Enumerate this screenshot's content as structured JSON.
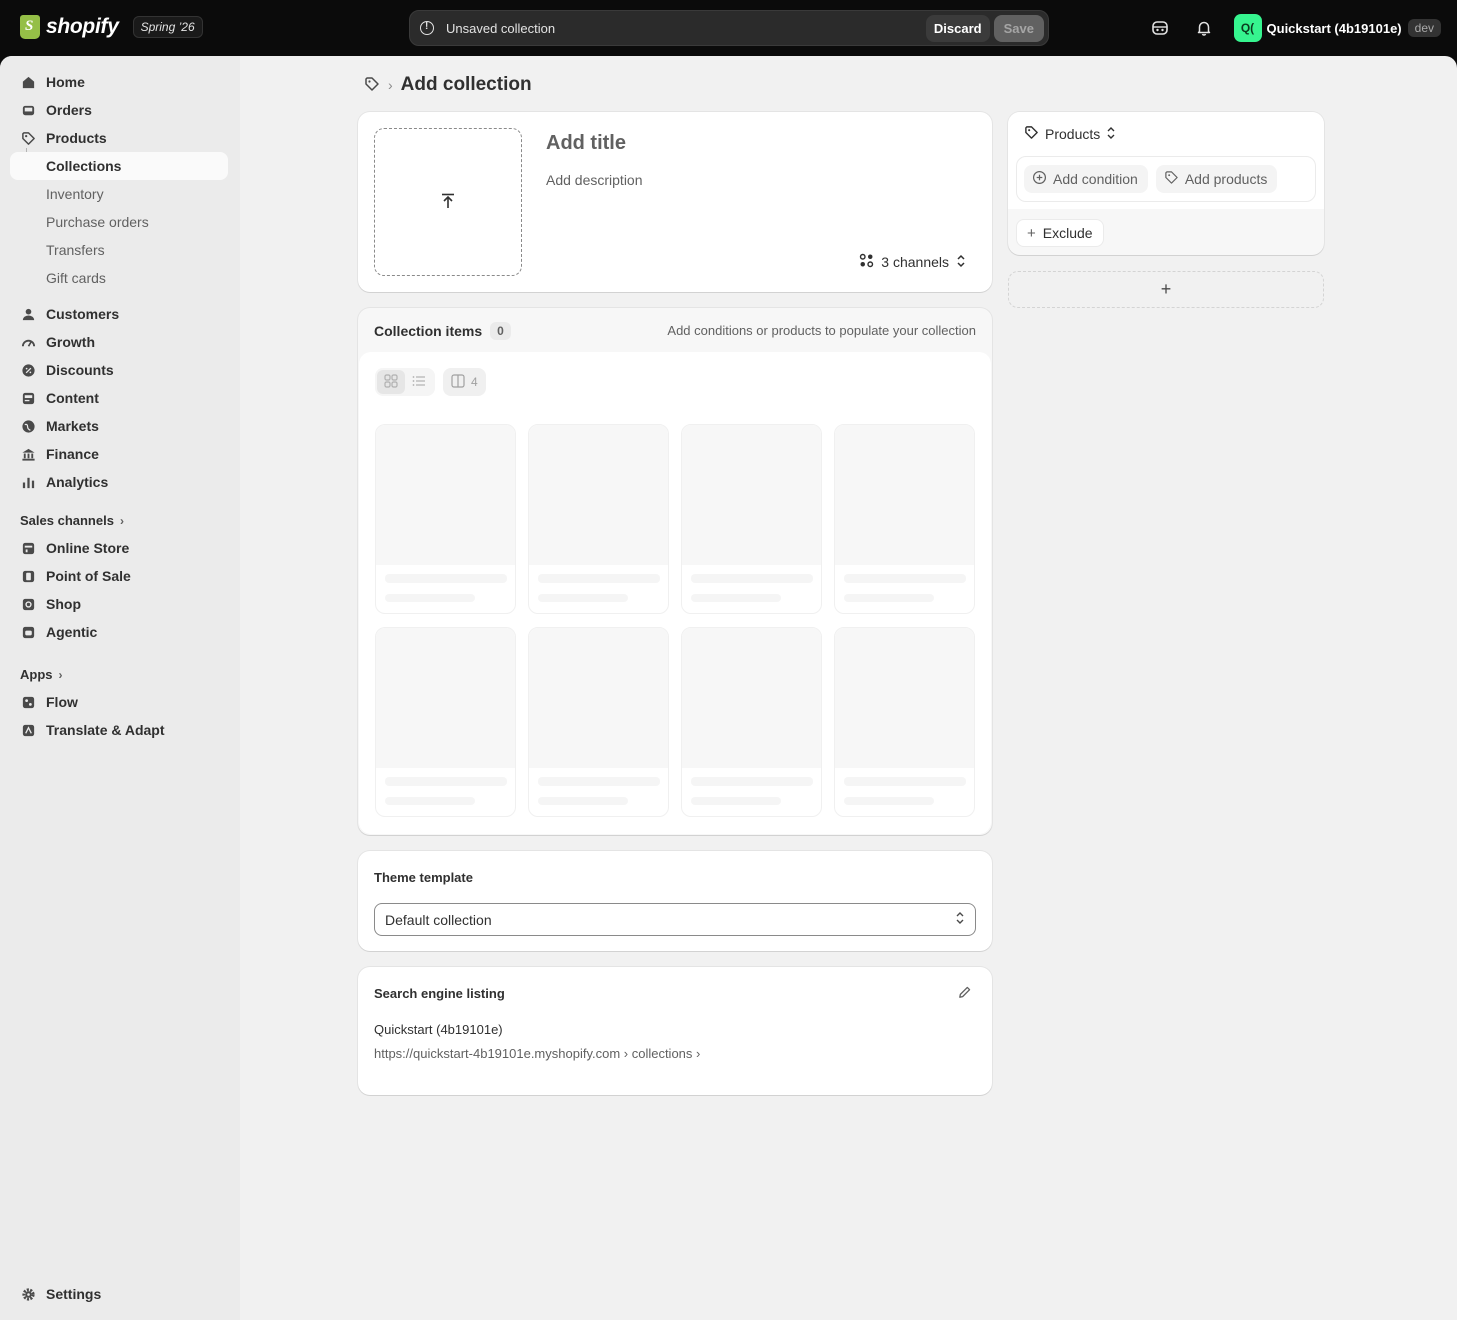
{
  "topbar": {
    "logo_word": "shopify",
    "edition_badge": "Spring ’26",
    "savebar_title": "Unsaved collection",
    "discard_label": "Discard",
    "save_label": "Save",
    "store_avatar": "Q(",
    "store_name": "Quickstart (4b19101e)",
    "env_badge": "dev",
    "icons": [
      "shopify-bag-icon",
      "alert-circle-icon",
      "sidekick-icon",
      "bell-icon"
    ],
    "colors": {
      "bar": "#0b0b0b",
      "avatar": "#36f58f",
      "logo_bag": "#95bf47"
    }
  },
  "sidebar": {
    "main": [
      {
        "label": "Home",
        "icon": "home-icon"
      },
      {
        "label": "Orders",
        "icon": "inbox-icon"
      },
      {
        "label": "Products",
        "icon": "tag-icon"
      }
    ],
    "product_subs": [
      {
        "label": "Collections",
        "active": true
      },
      {
        "label": "Inventory"
      },
      {
        "label": "Purchase orders"
      },
      {
        "label": "Transfers"
      },
      {
        "label": "Gift cards"
      }
    ],
    "secondary": [
      {
        "label": "Customers",
        "icon": "person-icon"
      },
      {
        "label": "Growth",
        "icon": "gauge-icon"
      },
      {
        "label": "Discounts",
        "icon": "discount-icon"
      },
      {
        "label": "Content",
        "icon": "content-icon"
      },
      {
        "label": "Markets",
        "icon": "globe-icon"
      },
      {
        "label": "Finance",
        "icon": "bank-icon"
      },
      {
        "label": "Analytics",
        "icon": "bar-chart-icon"
      }
    ],
    "sales_channels_label": "Sales channels",
    "channels": [
      {
        "label": "Online Store",
        "icon": "store-icon"
      },
      {
        "label": "Point of Sale",
        "icon": "pos-icon"
      },
      {
        "label": "Shop",
        "icon": "shop-icon"
      },
      {
        "label": "Agentic",
        "icon": "agentic-icon"
      }
    ],
    "apps_label": "Apps",
    "apps": [
      {
        "label": "Flow",
        "icon": "flow-icon"
      },
      {
        "label": "Translate & Adapt",
        "icon": "translate-icon"
      }
    ],
    "settings_label": "Settings"
  },
  "page": {
    "title": "Add collection",
    "breadcrumb_icon": "tag-icon"
  },
  "title_card": {
    "title_placeholder": "Add title",
    "description_placeholder": "Add description",
    "channels_label": "3 channels"
  },
  "items_card": {
    "title": "Collection items",
    "count": "0",
    "hint": "Add conditions or products to populate your collection",
    "columns": "4"
  },
  "theme_card": {
    "title": "Theme template",
    "selected": "Default collection"
  },
  "seo_card": {
    "title": "Search engine listing",
    "store": "Quickstart (4b19101e)",
    "url": "https://quickstart-4b19101e.myshopify.com › collections ›"
  },
  "rules_card": {
    "type_label": "Products",
    "add_condition": "Add condition",
    "add_products": "Add products",
    "exclude": "Exclude"
  }
}
